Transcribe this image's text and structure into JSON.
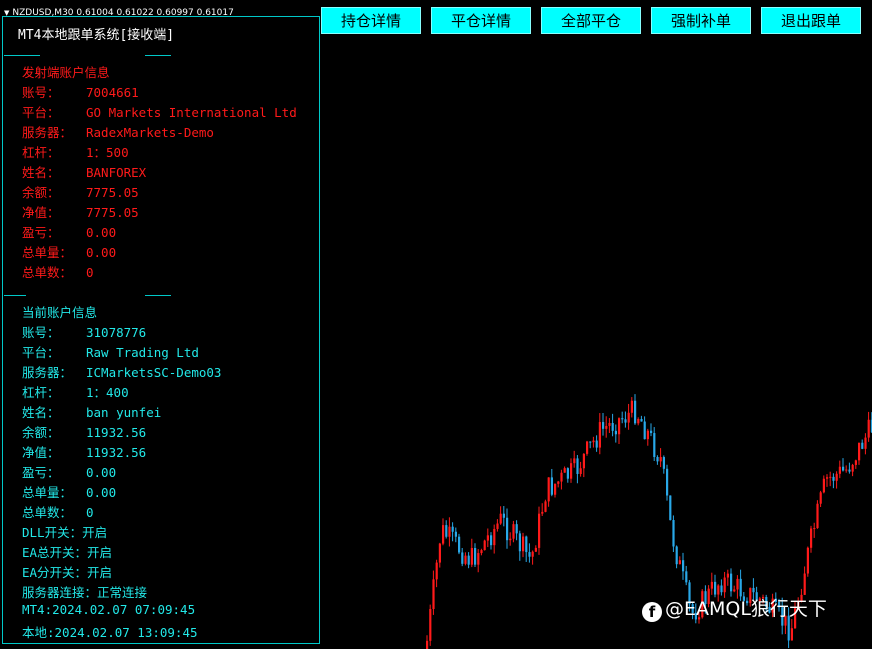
{
  "symbol_bar": {
    "text": "NZDUSD,M30  0.61004 0.61022 0.60997 0.61017"
  },
  "panel": {
    "title": "MT4本地跟单系统[接收端]",
    "sender": {
      "heading": "发射端账户信息",
      "rows": [
        {
          "label": "账号：",
          "value": "7004661"
        },
        {
          "label": "平台：",
          "value": "GO Markets International Ltd"
        },
        {
          "label": "服务器：",
          "value": "RadexMarkets-Demo"
        },
        {
          "label": "杠杆：",
          "value": "1：500"
        },
        {
          "label": "姓名：",
          "value": "BANFOREX"
        },
        {
          "label": "余额：",
          "value": "7775.05"
        },
        {
          "label": "净值：",
          "value": "7775.05"
        },
        {
          "label": "盈亏：",
          "value": "0.00"
        },
        {
          "label": "总单量：",
          "value": "0.00"
        },
        {
          "label": "总单数：",
          "value": "0"
        }
      ]
    },
    "current": {
      "heading": "当前账户信息",
      "rows": [
        {
          "label": "账号：",
          "value": "31078776"
        },
        {
          "label": "平台：",
          "value": "Raw Trading Ltd"
        },
        {
          "label": "服务器：",
          "value": "ICMarketsSC-Demo03"
        },
        {
          "label": "杠杆：",
          "value": "1：400"
        },
        {
          "label": "姓名：",
          "value": "ban yunfei"
        },
        {
          "label": "余额：",
          "value": "11932.56"
        },
        {
          "label": "净值：",
          "value": "11932.56"
        },
        {
          "label": "盈亏：",
          "value": "0.00"
        },
        {
          "label": "总单量：",
          "value": "0.00"
        },
        {
          "label": "总单数：",
          "value": "0"
        }
      ],
      "status": [
        "DLL开关：开启",
        "EA总开关：开启",
        "EA分开关：开启",
        "服务器连接：正常连接",
        "MT4:2024.02.07 07:09:45",
        "本地:2024.02.07 13:09:45"
      ]
    }
  },
  "buttons": [
    "持仓详情",
    "平仓详情",
    "全部平仓",
    "强制补单",
    "退出跟单"
  ],
  "watermark": "@EAMQL狼行天下",
  "colors": {
    "background": "#000000",
    "sender_text": "#ff1a1a",
    "current_text": "#22e8e8",
    "panel_border": "#00c8c8",
    "button_bg": "#00ffff",
    "bull_candle": "#ff1a1a",
    "bear_candle": "#29a8e8"
  }
}
